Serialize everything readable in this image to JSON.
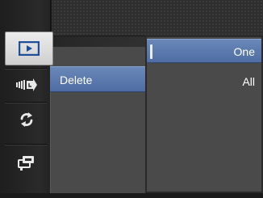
{
  "sidebar": {
    "tabs": [
      {
        "id": "playback",
        "icon": "playback-icon",
        "active": true
      },
      {
        "id": "effects",
        "icon": "burst-effects-icon",
        "active": false
      },
      {
        "id": "refresh",
        "icon": "rotate-icon",
        "active": false
      },
      {
        "id": "setup",
        "icon": "setup-icon",
        "active": false
      }
    ]
  },
  "menu": {
    "items": [
      {
        "label": "Delete",
        "selected": true
      }
    ]
  },
  "submenu": {
    "options": [
      {
        "label": "One",
        "selected": true
      },
      {
        "label": "All",
        "selected": false
      }
    ]
  },
  "colors": {
    "highlight": "#5a78ad",
    "panel": "#4a4a4a"
  }
}
